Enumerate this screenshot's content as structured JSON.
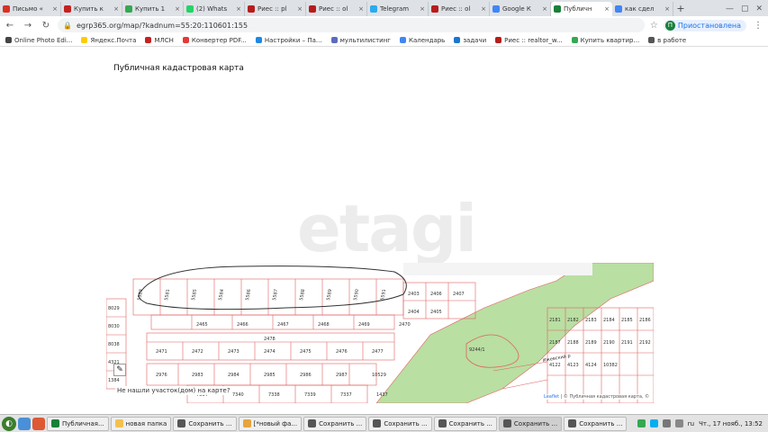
{
  "tabs": [
    {
      "title": "Письмо «",
      "color": "#d93025"
    },
    {
      "title": "Купить к",
      "color": "#c5221f"
    },
    {
      "title": "Купить 1",
      "color": "#34a853"
    },
    {
      "title": "(2) Whats",
      "color": "#25d366"
    },
    {
      "title": "Риес :: pl",
      "color": "#b71c1c"
    },
    {
      "title": "Риес :: ol",
      "color": "#b71c1c"
    },
    {
      "title": "Telegram",
      "color": "#2aabee"
    },
    {
      "title": "Риес :: ol",
      "color": "#b71c1c"
    },
    {
      "title": "Google К",
      "color": "#4285f4"
    },
    {
      "title": "Публичн",
      "color": "#188038"
    },
    {
      "title": "как сдел",
      "color": "#4285f4"
    }
  ],
  "address": {
    "url": "egrp365.org/map/?kadnum=55:20:110601:155",
    "profile_initial": "П",
    "profile_label": "Приостановлена"
  },
  "bookmarks": [
    {
      "label": "Online Photo Edi...",
      "color": "#444"
    },
    {
      "label": "Яндекс.Почта",
      "color": "#ffcc00"
    },
    {
      "label": "МЛСН",
      "color": "#c5221f"
    },
    {
      "label": "Конвертер PDF...",
      "color": "#e53935"
    },
    {
      "label": "Настройки – Па...",
      "color": "#1e88e5"
    },
    {
      "label": "мультилистинг",
      "color": "#5c6bc0"
    },
    {
      "label": "Календарь",
      "color": "#4285f4"
    },
    {
      "label": "задачи",
      "color": "#1976d2"
    },
    {
      "label": "Риес :: realtor_w...",
      "color": "#b71c1c"
    },
    {
      "label": "Купить квартир...",
      "color": "#34a853"
    },
    {
      "label": "в работе",
      "color": "#555"
    }
  ],
  "page": {
    "title": "Публичная кадастровая карта",
    "watermark": "etagi"
  },
  "map": {
    "not_found_prompt": "Не нашли участок(дом) на карте?",
    "attribution_leaflet": "Leaflet",
    "attribution_rest": " | © Публичная кадастровая карта, ©",
    "parcels_top": [
      "5583",
      "5581",
      "5585",
      "5584",
      "5586",
      "5587",
      "5588",
      "5589",
      "5590",
      "5591"
    ],
    "parcels_row2": [
      "2465",
      "2466",
      "2467",
      "2468",
      "2469",
      "2470"
    ],
    "parcels_row3": [
      "2478",
      "2471",
      "2472",
      "2473",
      "2474",
      "2475",
      "2476",
      "2477"
    ],
    "parcels_row4": [
      "2976",
      "2983",
      "2984",
      "2985",
      "2986",
      "2987",
      "10529"
    ],
    "parcels_row5": [
      "7334",
      "7340",
      "7338",
      "7339",
      "7337",
      "1437"
    ],
    "parcels_left": [
      "8029",
      "8030",
      "8038",
      "4321",
      "1384"
    ],
    "parcels_right": [
      "2403",
      "2406",
      "2407",
      "2404",
      "2405",
      "2181",
      "2182",
      "2183",
      "2184",
      "2185",
      "2186",
      "2187",
      "2188",
      "2189",
      "2190",
      "2191",
      "2192",
      "4122",
      "4123",
      "4124",
      "10382"
    ],
    "zone_label": "9244/1",
    "street_label": "Ижевский р"
  },
  "taskbar": {
    "items": [
      {
        "label": "Публичная...",
        "color": "#188038",
        "active": false
      },
      {
        "label": "новая папка",
        "color": "#f2c14e",
        "active": false
      },
      {
        "label": "Сохранить ...",
        "color": "#555",
        "active": false
      },
      {
        "label": "[*новый фа...",
        "color": "#e8a33d",
        "active": false
      },
      {
        "label": "Сохранить ...",
        "color": "#555",
        "active": false
      },
      {
        "label": "Сохранить ...",
        "color": "#555",
        "active": false
      },
      {
        "label": "Сохранить ...",
        "color": "#555",
        "active": false
      },
      {
        "label": "Сохранить ...",
        "color": "#555",
        "active": true
      },
      {
        "label": "Сохранить ...",
        "color": "#555",
        "active": false
      }
    ],
    "lang": "ru",
    "clock": "Чт., 17 нояб., 13:52"
  }
}
